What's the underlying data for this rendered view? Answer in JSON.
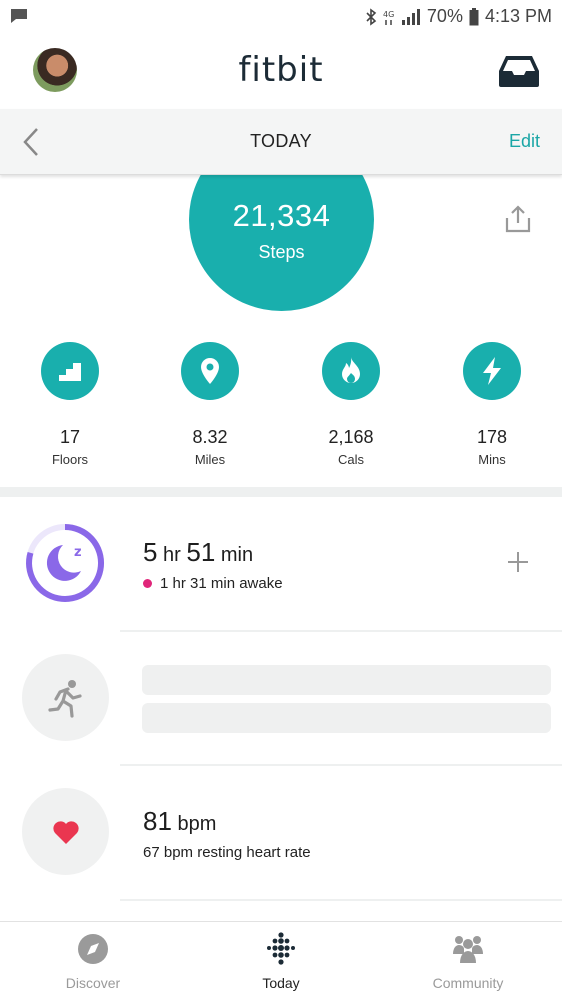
{
  "status_bar": {
    "battery": "70%",
    "time": "4:13 PM"
  },
  "app": {
    "brand": "fitbit"
  },
  "date_nav": {
    "title": "TODAY",
    "edit_label": "Edit"
  },
  "steps": {
    "value": "21,334",
    "label": "Steps"
  },
  "stats": [
    {
      "icon": "stairs-icon",
      "value": "17",
      "label": "Floors"
    },
    {
      "icon": "location-pin-icon",
      "value": "8.32",
      "label": "Miles"
    },
    {
      "icon": "flame-icon",
      "value": "2,168",
      "label": "Cals"
    },
    {
      "icon": "lightning-icon",
      "value": "178",
      "label": "Mins"
    }
  ],
  "sleep": {
    "hours": "5",
    "hr_unit": "hr",
    "minutes": "51",
    "min_unit": "min",
    "awake": "1 hr 31 min awake"
  },
  "heart": {
    "value": "81",
    "unit": "bpm",
    "resting": "67 bpm resting heart rate"
  },
  "bottom_nav": [
    {
      "icon": "compass-icon",
      "label": "Discover",
      "active": false
    },
    {
      "icon": "fitbit-dots-icon",
      "label": "Today",
      "active": true
    },
    {
      "icon": "community-icon",
      "label": "Community",
      "active": false
    }
  ],
  "colors": {
    "teal": "#19afad",
    "sleep_purple": "#8a68e8",
    "heart_red": "#ea3650",
    "awake_pink": "#e0267a",
    "edit_teal": "#1aa6a6"
  }
}
